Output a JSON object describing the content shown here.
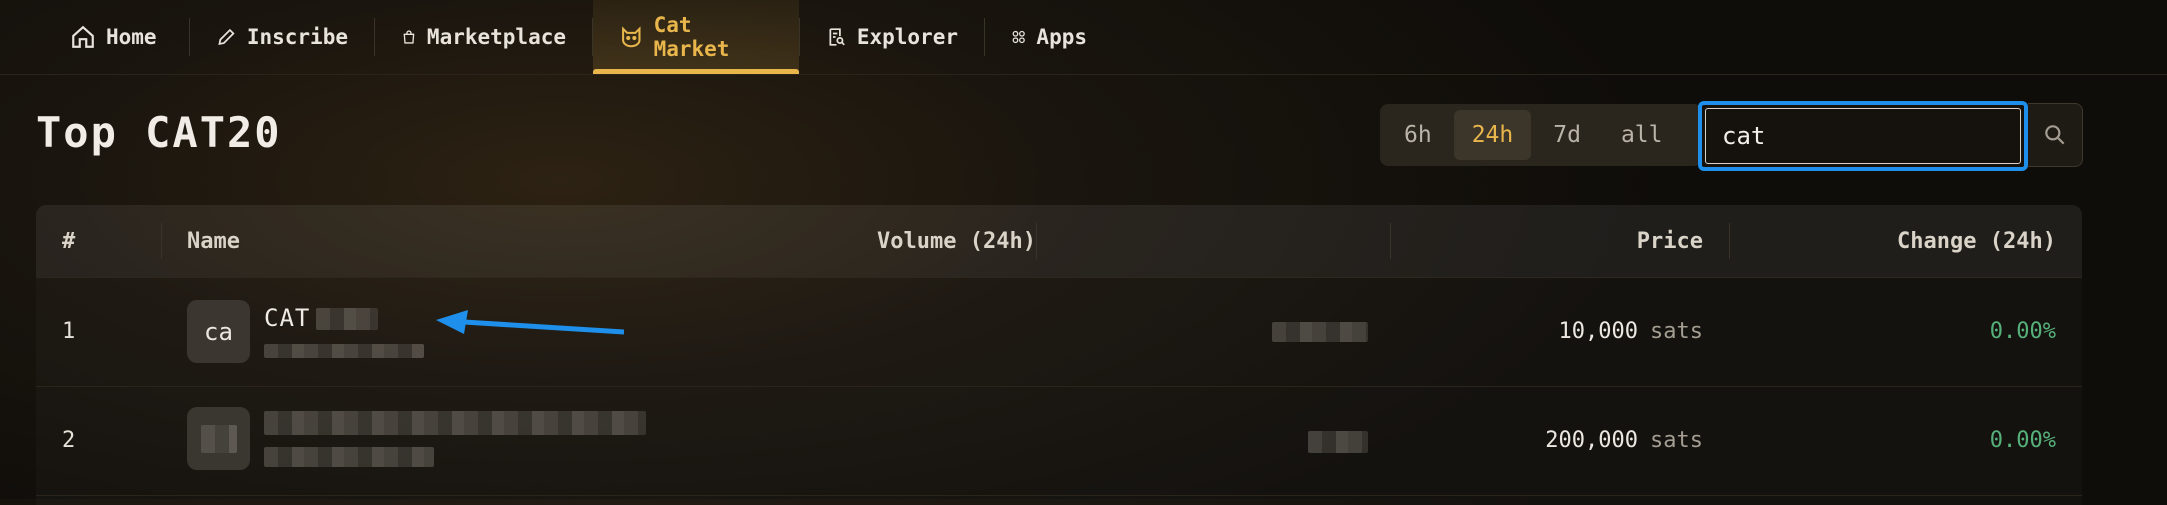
{
  "nav": {
    "items": [
      {
        "label": "Home",
        "icon": "home-icon",
        "active": false
      },
      {
        "label": "Inscribe",
        "icon": "pen-icon",
        "active": false
      },
      {
        "label": "Marketplace",
        "icon": "shopping-bag-icon",
        "active": false
      },
      {
        "label": "Cat Market",
        "icon": "cat-icon",
        "active": true
      },
      {
        "label": "Explorer",
        "icon": "search-document-icon",
        "active": false
      },
      {
        "label": "Apps",
        "icon": "apps-grid-icon",
        "active": false
      }
    ]
  },
  "page": {
    "title": "Top CAT20"
  },
  "time_filter": {
    "options": [
      "6h",
      "24h",
      "7d",
      "all"
    ],
    "selected": "24h"
  },
  "search": {
    "value": "cat",
    "placeholder": ""
  },
  "table": {
    "columns": [
      "#",
      "Name",
      "Volume (24h)",
      "Price",
      "Change (24h)"
    ],
    "rows": [
      {
        "rank": "1",
        "avatar_text": "ca",
        "name": "CAT",
        "price": "10,000",
        "price_unit": "sats",
        "change": "0.00%"
      },
      {
        "rank": "2",
        "avatar_text": "",
        "name": "",
        "price": "200,000",
        "price_unit": "sats",
        "change": "0.00%"
      }
    ]
  },
  "colors": {
    "accent": "#e9b64c",
    "focus": "#1e8fea",
    "positive": "#56b07a"
  }
}
